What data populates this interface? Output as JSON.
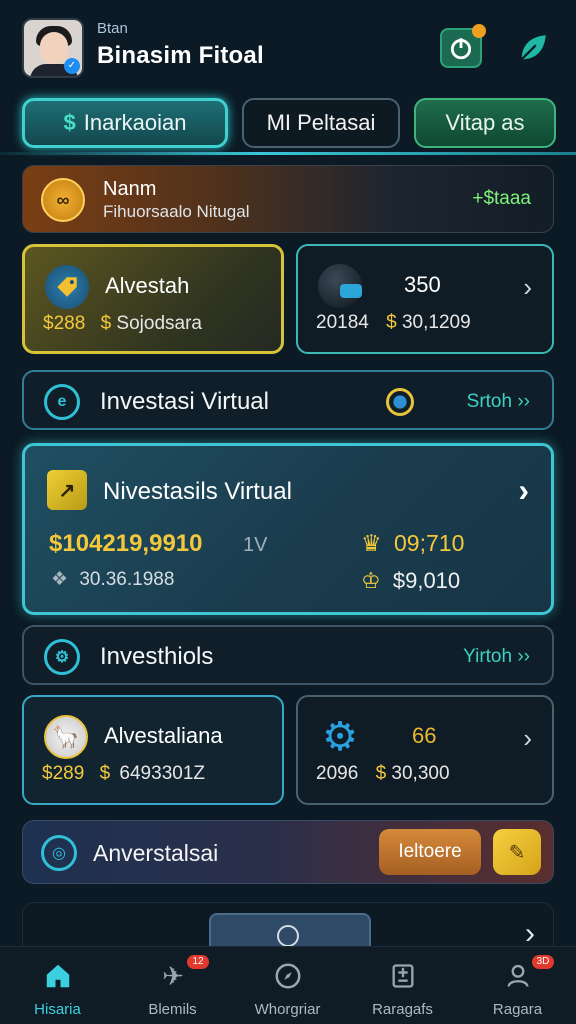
{
  "header": {
    "greeting": "Btan",
    "app_title": "Binasim Fitoal"
  },
  "tabs": [
    {
      "icon": "$",
      "label": "Inarkaoian"
    },
    {
      "label": "MI Peltasai"
    },
    {
      "label": "Vitap as"
    }
  ],
  "banner": {
    "title": "Nanm",
    "subtitle": "Fihuorsaalo Nitugal",
    "value": "+$taaa"
  },
  "cards_top": [
    {
      "title": "Alvestah",
      "amount": "$288",
      "amount_note": "Sojodsara"
    },
    {
      "title": "350",
      "amount": "20184",
      "amount_note": "30,1209"
    }
  ],
  "section_virtual": {
    "label": "Investasi Virtual",
    "link": "Srtoh ››"
  },
  "feature": {
    "title": "Nivestasils Virtual",
    "main_value": "$104219,9910",
    "main_suffix": "1V",
    "sub_value": "30.36.1988",
    "right_value_1": "09;710",
    "right_value_2": "$9,010"
  },
  "section_invest": {
    "label": "Investhiols",
    "link": "Yirtoh ››"
  },
  "cards_bottom": [
    {
      "title": "Alvestaliana",
      "amount": "$289",
      "amount_note": "6493301Z"
    },
    {
      "title": "66",
      "amount": "2096",
      "amount_note": "30,300"
    }
  ],
  "promo": {
    "label": "Anverstalsai",
    "button": "Ieltoere"
  },
  "bottom_nav": [
    {
      "label": "Hisaria",
      "badge": ""
    },
    {
      "label": "Blemils",
      "badge": "12"
    },
    {
      "label": "Whorgriar",
      "badge": ""
    },
    {
      "label": "Raragafs",
      "badge": ""
    },
    {
      "label": "Ragara",
      "badge": "3D"
    }
  ],
  "colors": {
    "accent": "#3ad0e0",
    "gold": "#f3c93b",
    "green": "#7ef27a",
    "background": "#0b1a24"
  }
}
